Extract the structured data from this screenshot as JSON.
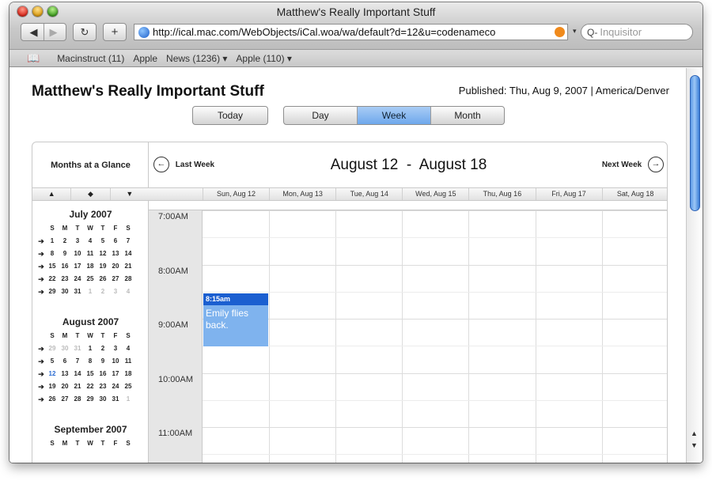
{
  "window": {
    "title": "Matthew's Really Important Stuff",
    "url": "http://ical.mac.com/WebObjects/iCal.woa/wa/default?d=12&u=codenameco",
    "search_placeholder": "Inquisitor",
    "back_glyph": "◀",
    "forward_glyph": "▶",
    "reload_glyph": "↻",
    "add_glyph": "+",
    "search_glyph": "Q-",
    "dropdown_glyph": "▾"
  },
  "bookmarks": {
    "icon_glyph": "📖",
    "items": [
      "Macinstruct (11)",
      "Apple",
      "News (1236) ▾",
      "Apple (110) ▾"
    ]
  },
  "page": {
    "title": "Matthew's Really Important Stuff",
    "published": "Published: Thu, Aug 9, 2007  |  America/Denver",
    "today_label": "Today",
    "views": [
      "Day",
      "Week",
      "Month"
    ],
    "active_view": "Week"
  },
  "sidebar": {
    "title": "Months at a Glance",
    "nav": [
      "▲",
      "◆",
      "▼"
    ],
    "weekday_initials": [
      "S",
      "M",
      "T",
      "W",
      "T",
      "F",
      "S"
    ],
    "row_arrow": "➔",
    "months": [
      {
        "name": "July 2007",
        "weeks": [
          [
            "1",
            "2",
            "3",
            "4",
            "5",
            "6",
            "7"
          ],
          [
            "8",
            "9",
            "10",
            "11",
            "12",
            "13",
            "14"
          ],
          [
            "15",
            "16",
            "17",
            "18",
            "19",
            "20",
            "21"
          ],
          [
            "22",
            "23",
            "24",
            "25",
            "26",
            "27",
            "28"
          ],
          [
            "29",
            "30",
            "31",
            "1",
            "2",
            "3",
            "4"
          ]
        ],
        "dim": [
          [
            4,
            3
          ],
          [
            4,
            4
          ],
          [
            4,
            5
          ],
          [
            4,
            6
          ]
        ]
      },
      {
        "name": "August 2007",
        "weeks": [
          [
            "29",
            "30",
            "31",
            "1",
            "2",
            "3",
            "4"
          ],
          [
            "5",
            "6",
            "7",
            "8",
            "9",
            "10",
            "11"
          ],
          [
            "12",
            "13",
            "14",
            "15",
            "16",
            "17",
            "18"
          ],
          [
            "19",
            "20",
            "21",
            "22",
            "23",
            "24",
            "25"
          ],
          [
            "26",
            "27",
            "28",
            "29",
            "30",
            "31",
            "1"
          ]
        ],
        "dim": [
          [
            0,
            0
          ],
          [
            0,
            1
          ],
          [
            0,
            2
          ],
          [
            4,
            6
          ]
        ],
        "highlight": [
          [
            2,
            0
          ]
        ]
      },
      {
        "name": "September 2007",
        "weeks": []
      }
    ]
  },
  "calendar": {
    "last_week_label": "Last Week",
    "next_week_label": "Next Week",
    "last_glyph": "←",
    "next_glyph": "→",
    "range": "August 12  -  August 18",
    "days": [
      "Sun, Aug 12",
      "Mon, Aug 13",
      "Tue, Aug 14",
      "Wed, Aug 15",
      "Thu, Aug 16",
      "Fri, Aug 17",
      "Sat, Aug 18"
    ],
    "times": [
      "7:00AM",
      "8:00AM",
      "9:00AM",
      "10:00AM",
      "11:00AM"
    ],
    "events": [
      {
        "time": "8:15am",
        "title": "Emily flies back.",
        "day": "Sun, Aug 12"
      }
    ]
  },
  "colors": {
    "event_header": "#1b5fd0",
    "event_body": "#7fb3ee",
    "active_tab": "#6ea8ec"
  }
}
